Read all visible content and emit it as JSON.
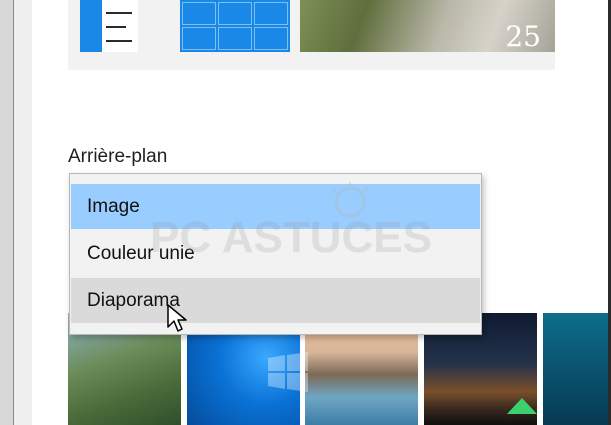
{
  "preview": {
    "clock_text": "25"
  },
  "background_section": {
    "label": "Arrière-plan"
  },
  "dropdown": {
    "options": [
      {
        "label": "Image",
        "state": "selected"
      },
      {
        "label": "Couleur unie",
        "state": "normal"
      },
      {
        "label": "Diaporama",
        "state": "hover"
      }
    ]
  },
  "watermark": {
    "text": "PC ASTUCES"
  },
  "colors": {
    "accent": "#1a88e6",
    "selected_bg": "#99ccff",
    "hover_bg": "#dadada"
  },
  "icons": [
    "windows-logo-icon",
    "mouse-cursor-icon"
  ]
}
